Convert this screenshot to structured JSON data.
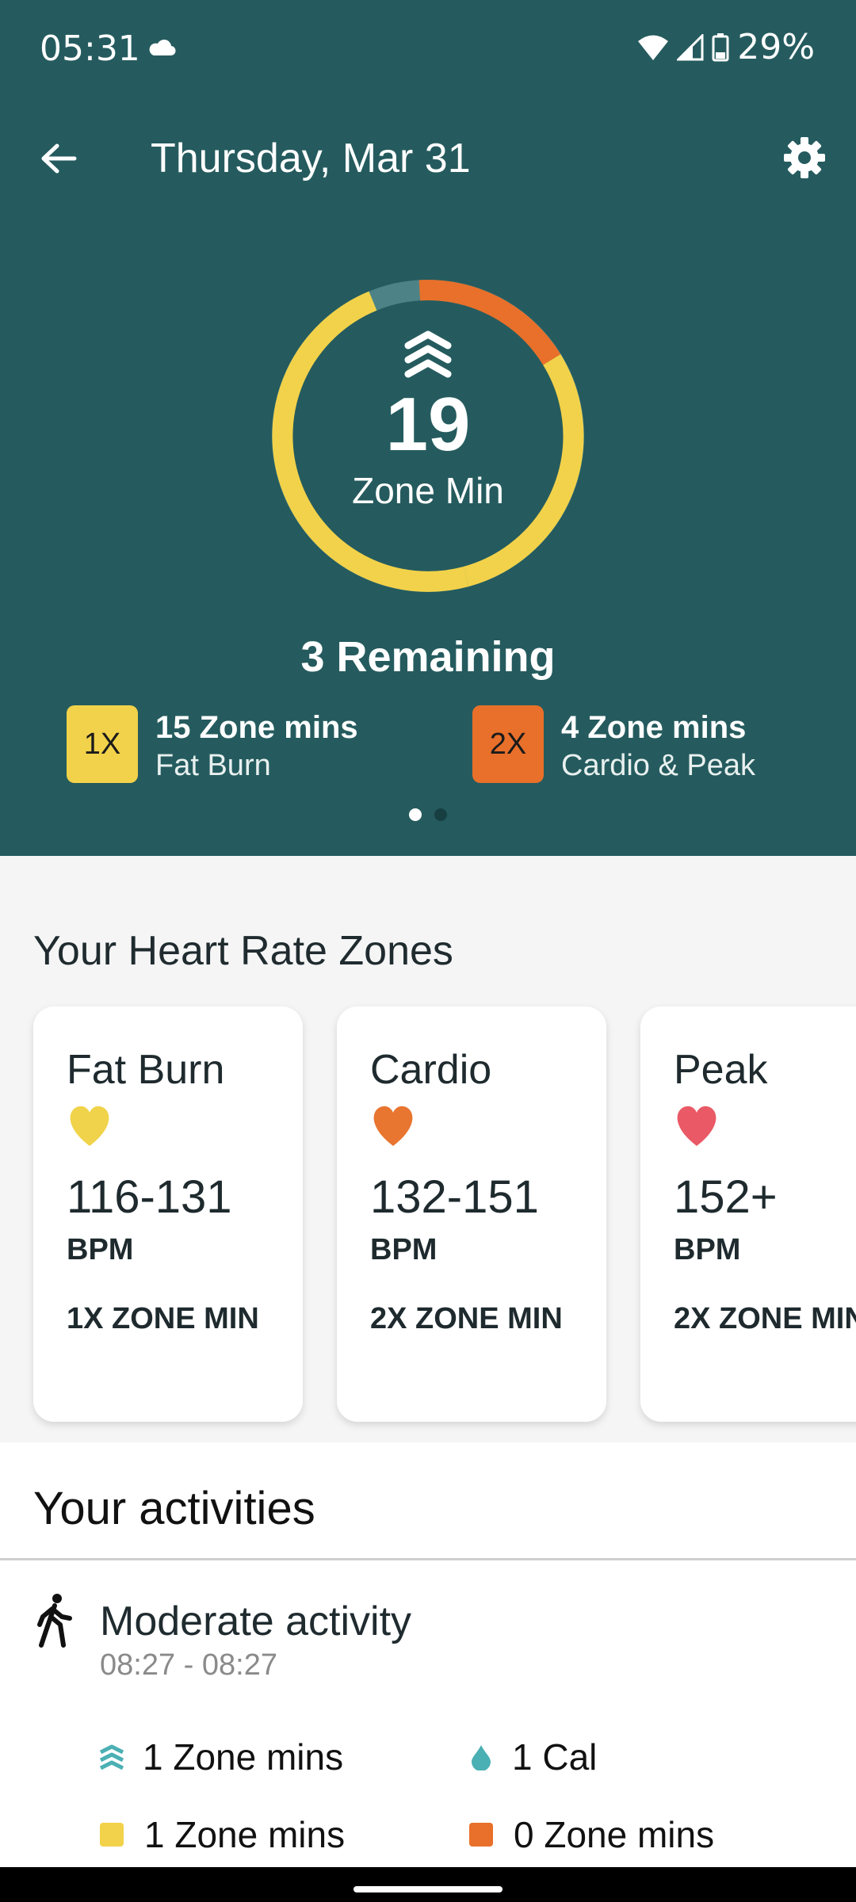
{
  "status_bar": {
    "time": "05:31",
    "battery": "29%"
  },
  "header": {
    "title": "Thursday, Mar 31"
  },
  "summary": {
    "value": "19",
    "label": "Zone Min",
    "remaining": "3 Remaining",
    "progress_fraction": 0.86,
    "legend": [
      {
        "badge": "1X",
        "title": "15 Zone mins",
        "subtitle": "Fat Burn",
        "color": "#f2d24a"
      },
      {
        "badge": "2X",
        "title": "4 Zone mins",
        "subtitle": "Cardio & Peak",
        "color": "#e8702a"
      }
    ]
  },
  "zones": {
    "title": "Your Heart Rate Zones",
    "cards": [
      {
        "name": "Fat Burn",
        "range": "116-131",
        "unit": "BPM",
        "multiplier": "1X ZONE MIN",
        "heart_color": "#f0d34a"
      },
      {
        "name": "Cardio",
        "range": "132-151",
        "unit": "BPM",
        "multiplier": "2X ZONE MIN",
        "heart_color": "#e87530"
      },
      {
        "name": "Peak",
        "range": "152+",
        "unit": "BPM",
        "multiplier": "2X ZONE MIN",
        "heart_color": "#e95a66"
      }
    ]
  },
  "activities": {
    "title": "Your activities",
    "item": {
      "name": "Moderate activity",
      "time": "08:27 - 08:27",
      "metrics": [
        {
          "text": "1 Zone mins",
          "icon": "zone-chevrons-icon"
        },
        {
          "text": "1 Cal",
          "icon": "calorie-drop-icon"
        },
        {
          "text": "1 Zone mins",
          "icon": "yellow-square",
          "color": "#f2d24a"
        },
        {
          "text": "0 Zone mins",
          "icon": "orange-square",
          "color": "#e8702a"
        }
      ]
    }
  },
  "colors": {
    "hero_bg": "#255b5e",
    "ring_track": "#4d8386",
    "ring_yellow": "#f2d24a",
    "ring_orange": "#e8702a"
  }
}
